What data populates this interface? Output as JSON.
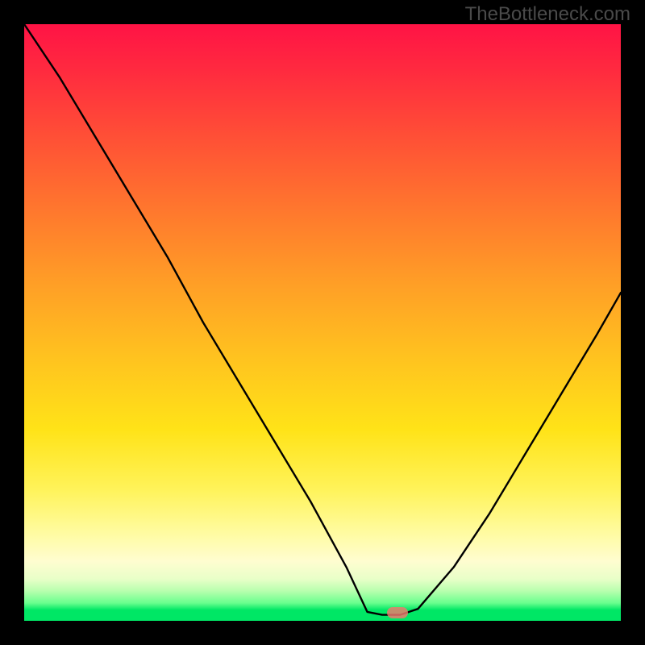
{
  "watermark": "TheBottleneck.com",
  "marker": {
    "x_frac": 0.625,
    "y_frac": 0.987
  },
  "chart_data": {
    "type": "line",
    "title": "",
    "xlabel": "",
    "ylabel": "",
    "xlim": [
      0,
      1
    ],
    "ylim": [
      0,
      1
    ],
    "series": [
      {
        "name": "bottleneck-curve",
        "x": [
          0.0,
          0.06,
          0.12,
          0.18,
          0.24,
          0.3,
          0.36,
          0.42,
          0.48,
          0.54,
          0.575,
          0.6,
          0.63,
          0.66,
          0.72,
          0.78,
          0.84,
          0.9,
          0.96,
          1.0
        ],
        "y": [
          1.0,
          0.91,
          0.81,
          0.71,
          0.61,
          0.5,
          0.4,
          0.3,
          0.2,
          0.09,
          0.015,
          0.01,
          0.01,
          0.02,
          0.09,
          0.18,
          0.28,
          0.38,
          0.48,
          0.55
        ]
      }
    ],
    "marker_point": {
      "x": 0.625,
      "y": 0.013
    },
    "background": "red-to-green vertical gradient",
    "grid": false,
    "legend": false
  }
}
